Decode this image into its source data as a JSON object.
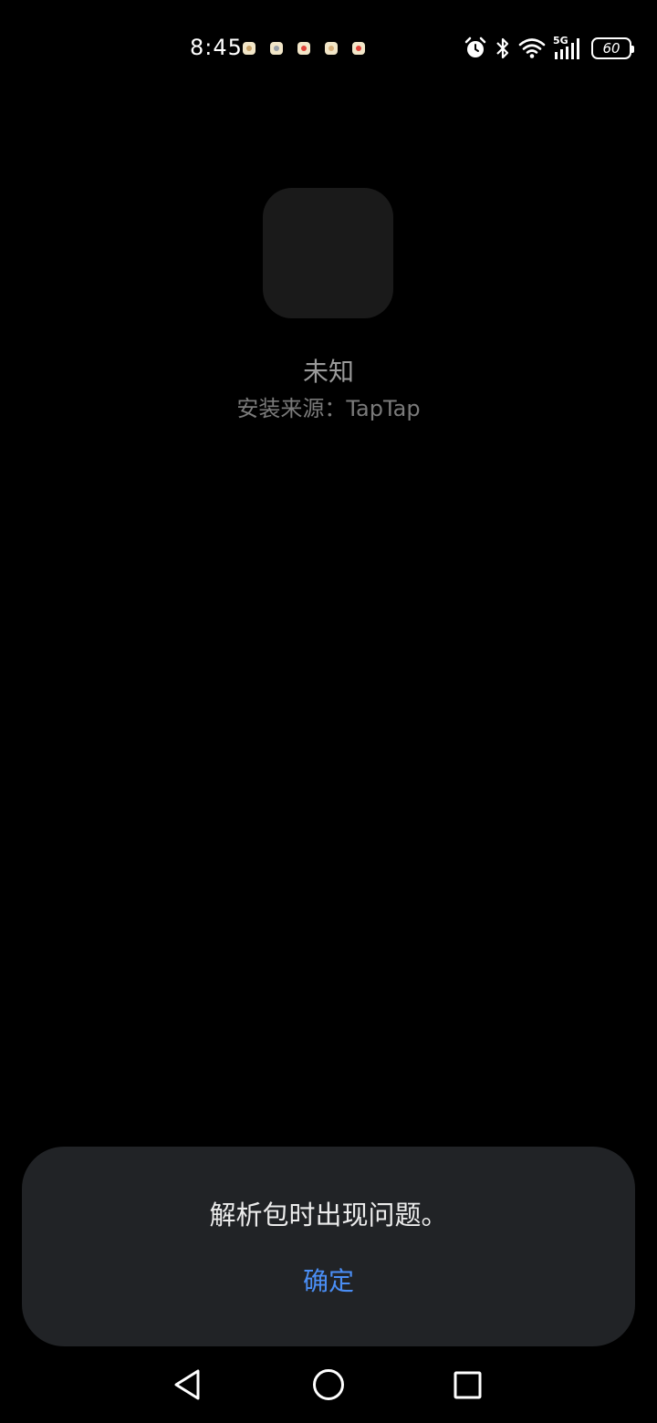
{
  "status_bar": {
    "time": "8:45",
    "notification_icons": [
      "app-notification-icon",
      "app-notification-icon",
      "app-notification-icon",
      "app-notification-icon",
      "app-notification-icon"
    ],
    "network": "5G",
    "battery_level": "60"
  },
  "app": {
    "name": "未知",
    "install_source": "安装来源：TapTap"
  },
  "dialog": {
    "message": "解析包时出现问题。",
    "confirm_label": "确定",
    "accent_color": "#4a8ef5"
  },
  "nav": {
    "back_icon": "back-triangle-icon",
    "home_icon": "home-circle-icon",
    "recents_icon": "recents-square-icon"
  }
}
